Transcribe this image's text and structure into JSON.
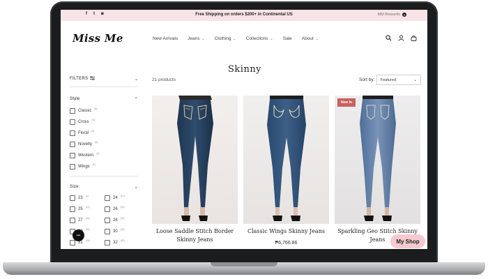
{
  "announcement": {
    "social": [
      "f",
      "t",
      "◙"
    ],
    "text": "Free Shipping on orders $200+ in Continental US",
    "rewards": "MM Rewards"
  },
  "header": {
    "logo": "Miss Me",
    "nav": [
      {
        "label": "New Arrivals",
        "dropdown": false
      },
      {
        "label": "Jeans",
        "dropdown": true
      },
      {
        "label": "Clothing",
        "dropdown": true
      },
      {
        "label": "Collections",
        "dropdown": true
      },
      {
        "label": "Sale",
        "dropdown": false
      },
      {
        "label": "About",
        "dropdown": true
      }
    ],
    "icons": [
      "search-icon",
      "account-icon",
      "cart-icon"
    ]
  },
  "filters": {
    "label": "FILTERS",
    "style": {
      "title": "Style",
      "options": [
        {
          "label": "Classic",
          "count": "(8)"
        },
        {
          "label": "Cross",
          "count": "(3)"
        },
        {
          "label": "Floral",
          "count": "(4)"
        },
        {
          "label": "Novelty",
          "count": "(3)"
        },
        {
          "label": "Western",
          "count": "(2)"
        },
        {
          "label": "Wings",
          "count": "(1)"
        }
      ]
    },
    "size": {
      "title": "Size",
      "options": [
        {
          "label": "23",
          "count": "(1)"
        },
        {
          "label": "24",
          "count": "(11)"
        },
        {
          "label": "25",
          "count": "(17)"
        },
        {
          "label": "26",
          "count": "(21)"
        },
        {
          "label": "27",
          "count": "(21)"
        },
        {
          "label": "28",
          "count": "(21)"
        },
        {
          "label": "29",
          "count": "(21)"
        },
        {
          "label": "30",
          "count": "(21)"
        },
        {
          "label": "31",
          "count": "(20)"
        },
        {
          "label": "32",
          "count": "(21)"
        }
      ]
    }
  },
  "main": {
    "title": "Skinny",
    "count": "21 products",
    "sort_label": "Sort by:",
    "sort_value": "Featured",
    "products": [
      {
        "title": "Loose Saddle Stitch Border Skinny Jeans",
        "price": "",
        "badge": ""
      },
      {
        "title": "Classic Wings Skinny Jeans",
        "price": "₱6,766.86",
        "badge": ""
      },
      {
        "title": "Sparkling Geo Stitch Skinny Jeans",
        "price": "",
        "badge": "New in"
      }
    ]
  },
  "widgets": {
    "chat": "•••",
    "my_shop": "My Shop"
  },
  "colors": {
    "announcement_bg": "#f8e3e6",
    "badge": "#c9615f",
    "my_shop_bg": "#f4c9cf"
  }
}
